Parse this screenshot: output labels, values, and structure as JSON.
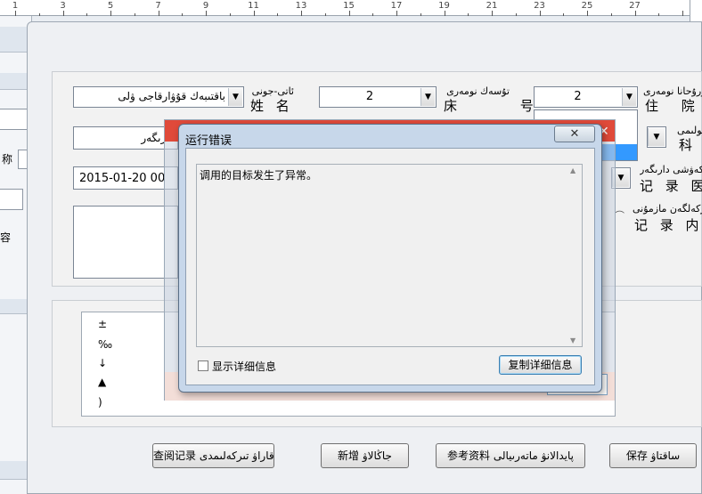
{
  "ruler": {
    "numbers": [
      "1",
      "3",
      "5",
      "7",
      "9",
      "11",
      "13",
      "15",
      "17",
      "19",
      "21",
      "23",
      "25",
      "27"
    ]
  },
  "background_window": {
    "label_1": "称",
    "label_2": "容"
  },
  "form": {
    "name_label_ug": "ئاتى-جونى",
    "name_label_cn": "姓 名",
    "name_value": "باقتىبەك قۇۋارقاجى ۋلى",
    "bed_label_ug": "تۇسەك نومەرى",
    "bed_label_cn": "床 号",
    "bed_value": "2",
    "admission_label_ug": "ئاۋرۇحانا نومەرى",
    "admission_label_cn": "住 院 号",
    "admission_value": "2",
    "dept_label_ug": "ءبولىمى",
    "dept_label_cn": "科 别",
    "second_field_value": "دارىگەر",
    "date_value": "2015-01-20 00",
    "doctor_label_ug": "تىركەۋشى دارىگەر",
    "doctor_label_cn": "记 录 医 师",
    "content_label_ug": "تىركەلگەن مازمۇنى",
    "content_label_cn": "记 录 内 容",
    "symbols": [
      "±",
      "‰",
      "↓",
      "▲",
      ")"
    ]
  },
  "buttons": {
    "query": "查阅记录 قاراۋ تىركەلىمدى",
    "new": "新增 جاڭالاۋ",
    "reference": "参考资料 پايدالانۋ ماتەرىيالى",
    "save": "保存 ساقتاۋ"
  },
  "dialog": {
    "title": "运行错误",
    "close_glyph": "✕",
    "message": "调用的目标发生了异常。",
    "show_details": "显示详细信息",
    "copy_details": "复制详细信息"
  }
}
